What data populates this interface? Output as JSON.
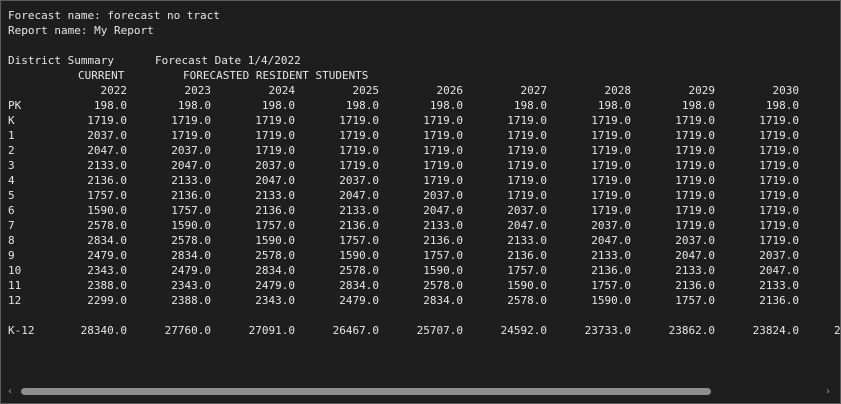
{
  "report": {
    "forecast_name": "Forecast name: forecast no tract",
    "report_name": "Report name: My Report",
    "summary_title": "District Summary",
    "forecast_date": "Forecast Date 1/4/2022",
    "current_label": "CURRENT",
    "forecasted_label": "FORECASTED RESIDENT STUDENTS",
    "years": [
      "2022",
      "2023",
      "2024",
      "2025",
      "2026",
      "2027",
      "2028",
      "2029",
      "2030"
    ],
    "rows": [
      {
        "grade": "PK",
        "values": [
          "198.0",
          "198.0",
          "198.0",
          "198.0",
          "198.0",
          "198.0",
          "198.0",
          "198.0",
          "198.0"
        ]
      },
      {
        "grade": "K",
        "values": [
          "1719.0",
          "1719.0",
          "1719.0",
          "1719.0",
          "1719.0",
          "1719.0",
          "1719.0",
          "1719.0",
          "1719.0"
        ]
      },
      {
        "grade": "1",
        "values": [
          "2037.0",
          "1719.0",
          "1719.0",
          "1719.0",
          "1719.0",
          "1719.0",
          "1719.0",
          "1719.0",
          "1719.0"
        ]
      },
      {
        "grade": "2",
        "values": [
          "2047.0",
          "2037.0",
          "1719.0",
          "1719.0",
          "1719.0",
          "1719.0",
          "1719.0",
          "1719.0",
          "1719.0"
        ]
      },
      {
        "grade": "3",
        "values": [
          "2133.0",
          "2047.0",
          "2037.0",
          "1719.0",
          "1719.0",
          "1719.0",
          "1719.0",
          "1719.0",
          "1719.0"
        ]
      },
      {
        "grade": "4",
        "values": [
          "2136.0",
          "2133.0",
          "2047.0",
          "2037.0",
          "1719.0",
          "1719.0",
          "1719.0",
          "1719.0",
          "1719.0"
        ]
      },
      {
        "grade": "5",
        "values": [
          "1757.0",
          "2136.0",
          "2133.0",
          "2047.0",
          "2037.0",
          "1719.0",
          "1719.0",
          "1719.0",
          "1719.0"
        ]
      },
      {
        "grade": "6",
        "values": [
          "1590.0",
          "1757.0",
          "2136.0",
          "2133.0",
          "2047.0",
          "2037.0",
          "1719.0",
          "1719.0",
          "1719.0"
        ]
      },
      {
        "grade": "7",
        "values": [
          "2578.0",
          "1590.0",
          "1757.0",
          "2136.0",
          "2133.0",
          "2047.0",
          "2037.0",
          "1719.0",
          "1719.0"
        ]
      },
      {
        "grade": "8",
        "values": [
          "2834.0",
          "2578.0",
          "1590.0",
          "1757.0",
          "2136.0",
          "2133.0",
          "2047.0",
          "2037.0",
          "1719.0"
        ]
      },
      {
        "grade": "9",
        "values": [
          "2479.0",
          "2834.0",
          "2578.0",
          "1590.0",
          "1757.0",
          "2136.0",
          "2133.0",
          "2047.0",
          "2037.0"
        ]
      },
      {
        "grade": "10",
        "values": [
          "2343.0",
          "2479.0",
          "2834.0",
          "2578.0",
          "1590.0",
          "1757.0",
          "2136.0",
          "2133.0",
          "2047.0"
        ]
      },
      {
        "grade": "11",
        "values": [
          "2388.0",
          "2343.0",
          "2479.0",
          "2834.0",
          "2578.0",
          "1590.0",
          "1757.0",
          "2136.0",
          "2133.0"
        ]
      },
      {
        "grade": "12",
        "values": [
          "2299.0",
          "2388.0",
          "2343.0",
          "2479.0",
          "2834.0",
          "2578.0",
          "1590.0",
          "1757.0",
          "2136.0"
        ]
      }
    ],
    "total": {
      "grade": "K-12",
      "values": [
        "28340.0",
        "27760.0",
        "27091.0",
        "26467.0",
        "25707.0",
        "24592.0",
        "23733.0",
        "23862.0",
        "23824.0"
      ],
      "cutoff": "2"
    }
  },
  "scrollbar": {
    "left_arrow": "‹",
    "right_arrow": "›",
    "thumb_fraction": 0.86
  }
}
